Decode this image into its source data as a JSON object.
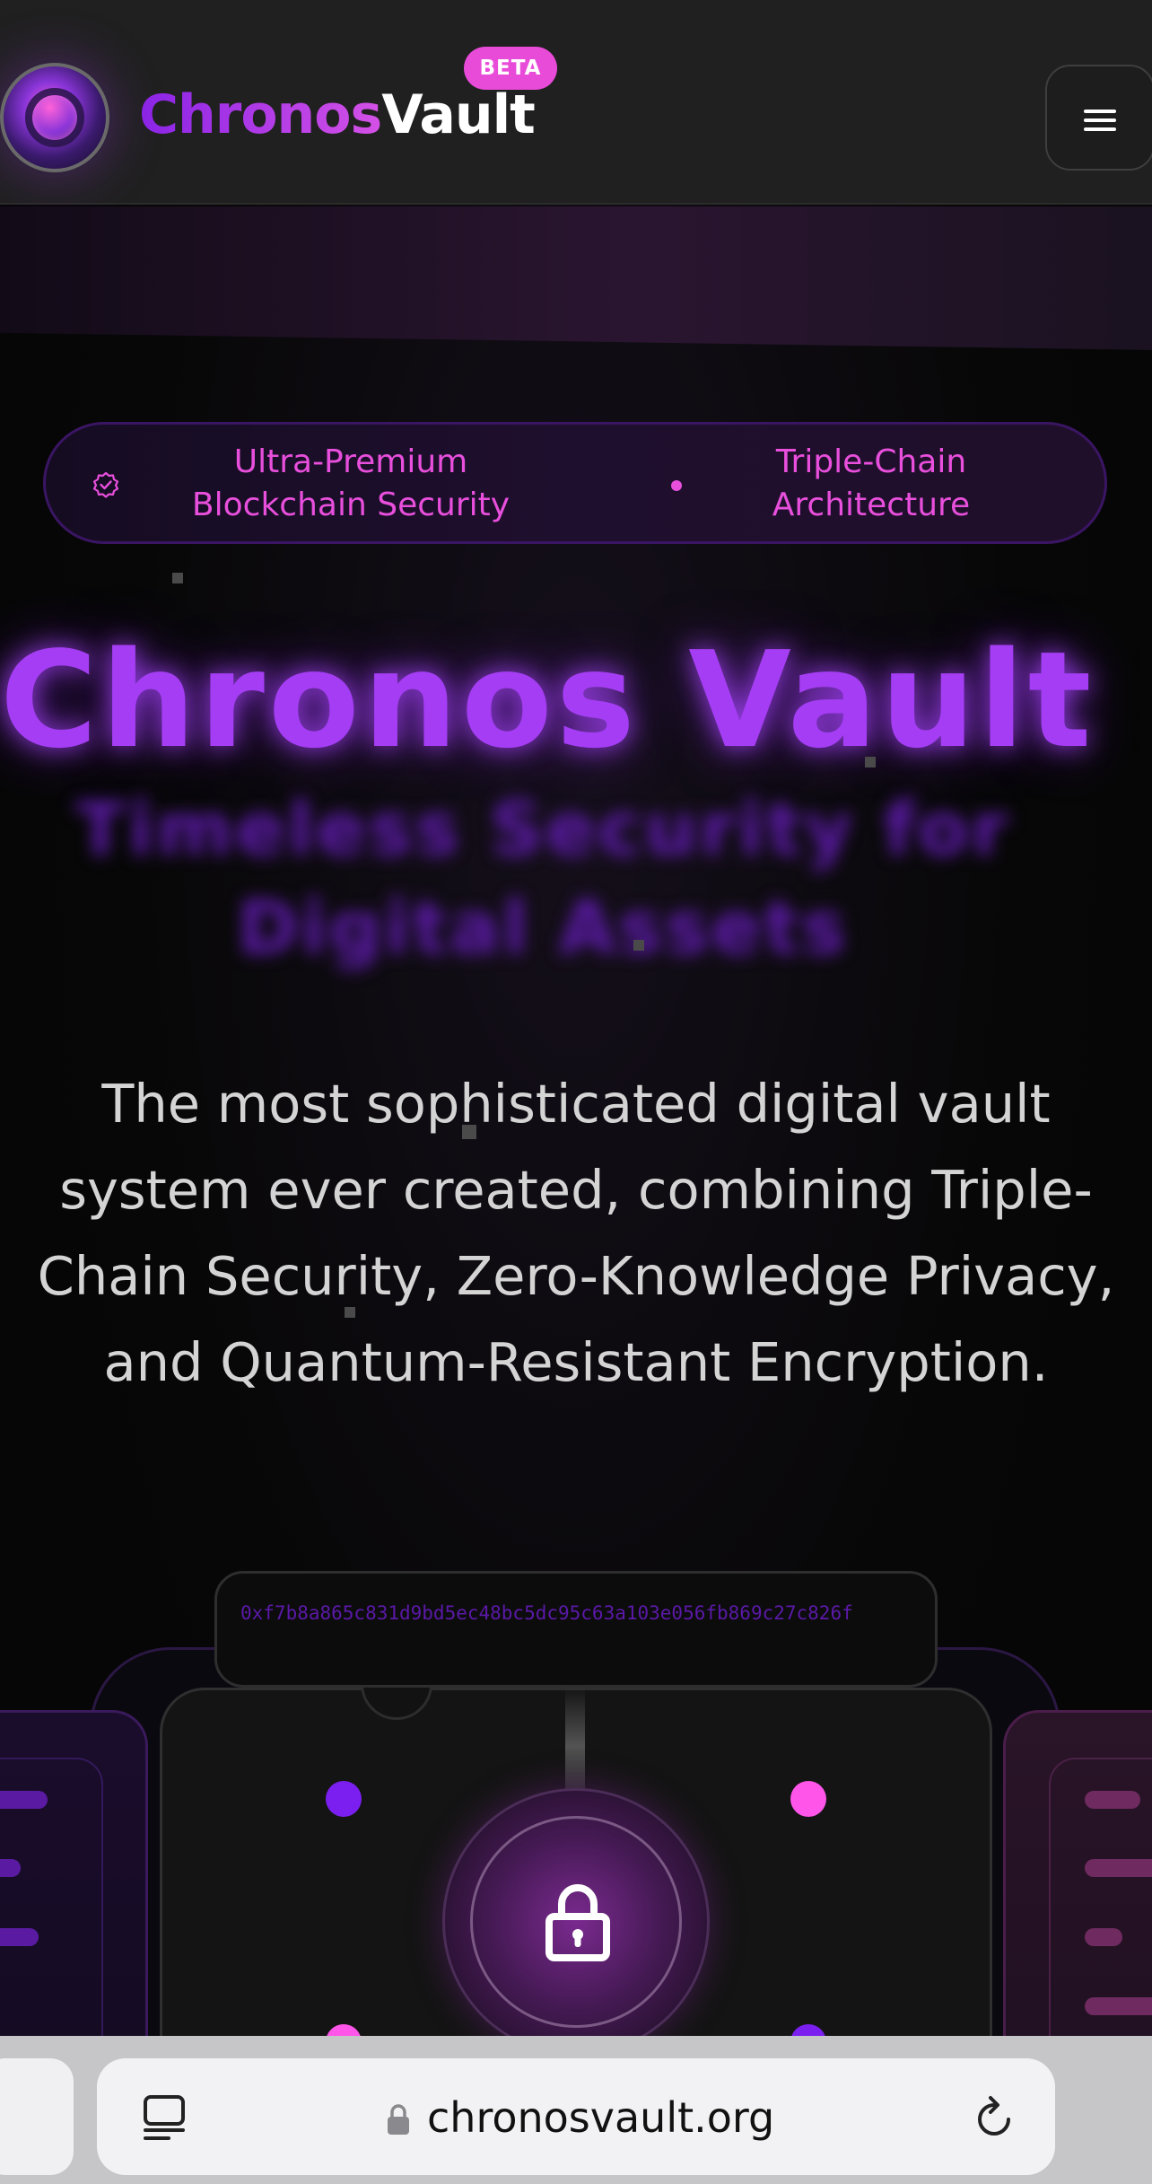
{
  "header": {
    "brand_part1": "Chronos",
    "brand_part2": "Vault",
    "badge": "BETA",
    "menu_icon": "hamburger-menu-icon",
    "logo_icon": "vault-dial-logo"
  },
  "hero": {
    "pill_items": [
      "Ultra-Premium Blockchain Security",
      "Triple-Chain Architecture"
    ],
    "pill_icon": "verified-badge-icon",
    "title": "Chronos Vault",
    "subtitle": "Timeless Security for Digital Assets",
    "description": "The most sophisticated digital vault system ever created, combining Triple-Chain Security, Zero-Knowledge Privacy, and Quantum-Resistant Encryption."
  },
  "vault_illustration": {
    "hash": "0xf7b8a865c831d9bd5ec48bc5dc95c63a103e056fb869c27c826f",
    "lock_icon": "padlock-icon"
  },
  "browser": {
    "url": "chronosvault.org",
    "icons": [
      "reader-mode-icon",
      "lock-icon",
      "reload-icon"
    ]
  },
  "colors": {
    "brand_purple": "#a43df3",
    "brand_pink": "#e84fdc",
    "badge_pink": "#e94bd9",
    "header_bg": "#202020"
  }
}
